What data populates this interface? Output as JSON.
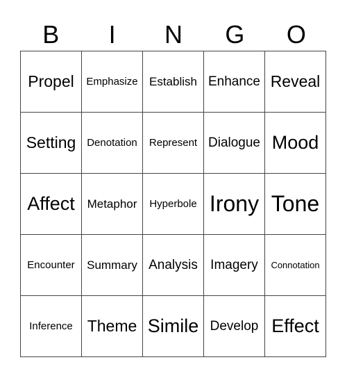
{
  "header": {
    "letters": [
      "B",
      "I",
      "N",
      "G",
      "O"
    ]
  },
  "card": {
    "rows": [
      [
        "Propel",
        "Emphasize",
        "Establish",
        "Enhance",
        "Reveal"
      ],
      [
        "Setting",
        "Denotation",
        "Represent",
        "Dialogue",
        "Mood"
      ],
      [
        "Affect",
        "Metaphor",
        "Hyperbole",
        "Irony",
        "Tone"
      ],
      [
        "Encounter",
        "Summary",
        "Analysis",
        "Imagery",
        "Connotation"
      ],
      [
        "Inference",
        "Theme",
        "Simile",
        "Develop",
        "Effect"
      ]
    ]
  }
}
